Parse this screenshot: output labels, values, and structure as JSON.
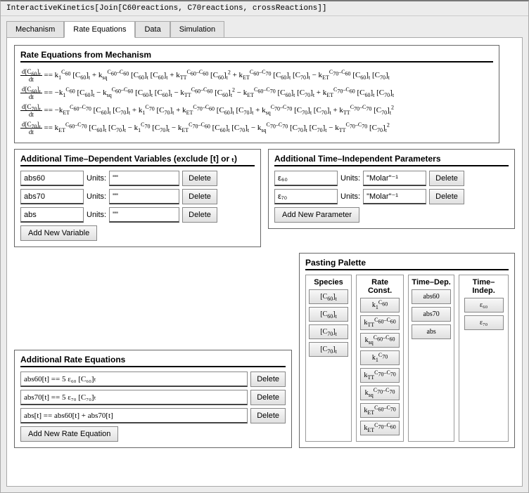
{
  "window": {
    "title": "InteractiveKinetics[Join[C60reactions, C70reactions, crossReactions]]"
  },
  "tabs": {
    "items": [
      "Mechanism",
      "Rate Equations",
      "Data",
      "Simulation"
    ],
    "active": 1
  },
  "rate_equations_panel": {
    "title": "Rate Equations from Mechanism",
    "equations": [
      "d[C₆₀]ₜ/dt == k₁^C₆₀ [C₆₀]ₜ + k_sq^C₆₀⁻C₆₀ [C₆₀]ₜ [C₆₀]ₜ + k_TT^C₆₀⁻C₆₀ [C₆₀]ₜ² + k_ET^C₆₀⁻C₇₀ [C₆₀]ₜ [C₇₀]ₜ − k_ET^C₇₀⁻C₆₀ [C₆₀]ₜ [C₇₀]ₜ",
      "d[C₆₀]ₜ/dt == −k₁^C₆₀ [C₆₀]ₜ − k_sq^C₆₀⁻C₆₀ [C₆₀]ₜ [C₆₀]ₜ − k_TT^C₆₀⁻C₆₀ [C₆₀]ₜ² − k_ET^C₆₀⁻C₇₀ [C₆₀]ₜ [C₇₀]ₜ + k_ET^C₇₀⁻C₆₀ [C₆₀]ₜ [C₇₀]ₜ",
      "d[C₇₀]ₜ/dt == −k_ET^C₆₀⁻C₇₀ [C₆₀]ₜ [C₇₀]ₜ + k₁^C₇₀ [C₇₀]ₜ + k_ET^C₇₀⁻C₆₀ [C₆₀]ₜ [C₇₀]ₜ + k_sq^C₇₀⁻C₇₀ [C₇₀]ₜ [C₇₀]ₜ + k_TT^C₇₀⁻C₇₀ [C₇₀]ₜ²",
      "d[C₇₀]ₜ/dt == k_ET^C₆₀⁻C₇₀ [C₆₀]ₜ [C₇₀]ₜ − k₁^C₇₀ [C₇₀]ₜ − k_ET^C₇₀⁻C₆₀ [C₆₀]ₜ [C₇₀]ₜ − k_sq^C₇₀⁻C₇₀ [C₇₀]ₜ [C₇₀]ₜ − k_TT^C₇₀⁻C₇₀ [C₇₀]ₜ²"
    ]
  },
  "time_dep_panel": {
    "title": "Additional Time–Dependent Variables (exclude [t] or ₜ)",
    "units_label": "Units:",
    "delete_label": "Delete",
    "add_label": "Add New Variable",
    "vars": [
      {
        "name": "abs60",
        "units": "\"\""
      },
      {
        "name": "abs70",
        "units": "\"\""
      },
      {
        "name": "abs",
        "units": "\"\""
      }
    ]
  },
  "time_indep_panel": {
    "title": "Additional Time–Independent Parameters",
    "units_label": "Units:",
    "delete_label": "Delete",
    "add_label": "Add New Parameter",
    "params": [
      {
        "name": "ε₆₀",
        "units": "\"Molar\"⁻¹"
      },
      {
        "name": "ε₇₀",
        "units": "\"Molar\"⁻¹"
      }
    ]
  },
  "additional_rate_panel": {
    "title": "Additional Rate Equations",
    "delete_label": "Delete",
    "add_label": "Add New Rate Equation",
    "equations": [
      "abs60[t] == 5 ε₆₀ [C₆₀]ₜ",
      "abs70[t] == 5 ε₇₀ [C₇₀]ₜ",
      "abs[t] == abs60[t] + abs70[t]"
    ]
  },
  "palette": {
    "title": "Pasting Palette",
    "columns": {
      "species": {
        "title": "Species",
        "items": [
          "[C₆₀]ₜ",
          "[C₆₀]ₜ",
          "[C₇₀]ₜ",
          "[C₇₀]ₜ"
        ]
      },
      "rate_const": {
        "title": "Rate Const.",
        "items": [
          "k₁^C₆₀",
          "k_TT^C₆₀⁻C₆₀",
          "k_sq^C₆₀⁻C₆₀",
          "k₁^C₇₀",
          "k_TT^C₇₀⁻C₇₀",
          "k_sq^C₇₀⁻C₇₀",
          "k_ET^C₆₀⁻C₇₀",
          "k_ET^C₇₀⁻C₆₀"
        ]
      },
      "time_dep": {
        "title": "Time–Dep.",
        "items": [
          "abs60",
          "abs70",
          "abs"
        ]
      },
      "time_indep": {
        "title": "Time–Indep.",
        "items": [
          "ε₆₀",
          "ε₇₀"
        ]
      }
    }
  }
}
